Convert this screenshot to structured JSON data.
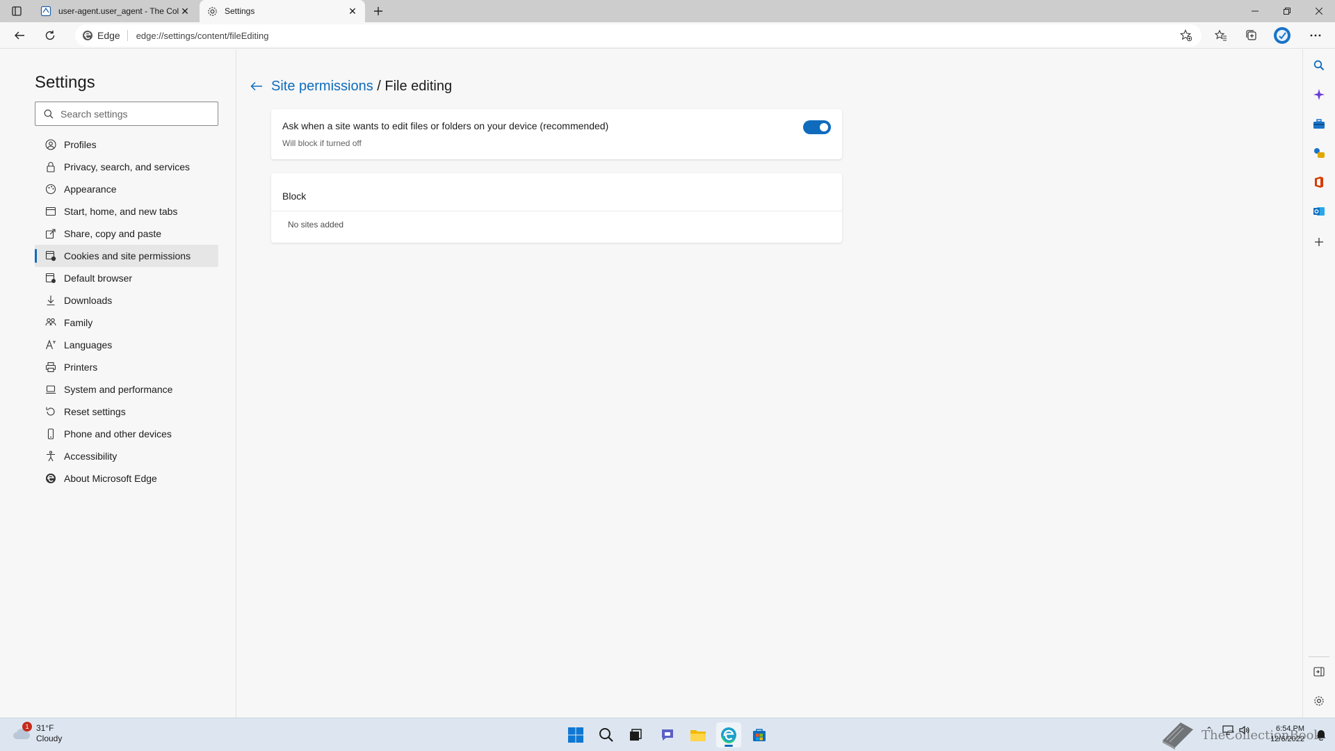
{
  "browser": {
    "tabs": [
      {
        "title": "user-agent.user_agent - The Coll",
        "icon": "document-tab-icon",
        "active": false
      },
      {
        "title": "Settings",
        "icon": "gear-icon",
        "active": true
      }
    ],
    "address": {
      "chip_label": "Edge",
      "url": "edge://settings/content/fileEditing"
    }
  },
  "settings": {
    "title": "Settings",
    "search_placeholder": "Search settings",
    "nav": [
      {
        "label": "Profiles",
        "icon": "profile-icon"
      },
      {
        "label": "Privacy, search, and services",
        "icon": "lock-icon"
      },
      {
        "label": "Appearance",
        "icon": "appearance-icon"
      },
      {
        "label": "Start, home, and new tabs",
        "icon": "home-tabs-icon"
      },
      {
        "label": "Share, copy and paste",
        "icon": "share-icon"
      },
      {
        "label": "Cookies and site permissions",
        "icon": "cookies-icon",
        "selected": true
      },
      {
        "label": "Default browser",
        "icon": "default-browser-icon"
      },
      {
        "label": "Downloads",
        "icon": "download-icon"
      },
      {
        "label": "Family",
        "icon": "family-icon"
      },
      {
        "label": "Languages",
        "icon": "languages-icon"
      },
      {
        "label": "Printers",
        "icon": "printer-icon"
      },
      {
        "label": "System and performance",
        "icon": "laptop-icon"
      },
      {
        "label": "Reset settings",
        "icon": "reset-icon"
      },
      {
        "label": "Phone and other devices",
        "icon": "phone-icon"
      },
      {
        "label": "Accessibility",
        "icon": "accessibility-icon"
      },
      {
        "label": "About Microsoft Edge",
        "icon": "edge-logo-icon"
      }
    ]
  },
  "page": {
    "breadcrumb_link": "Site permissions",
    "breadcrumb_sep": " / ",
    "breadcrumb_current": "File editing",
    "ask_label": "Ask when a site wants to edit files or folders on your device (recommended)",
    "ask_sub": "Will block if turned off",
    "ask_enabled": true,
    "block_heading": "Block",
    "block_empty": "No sites added"
  },
  "taskbar": {
    "weather_badge": "1",
    "temperature": "31°F",
    "condition": "Cloudy",
    "time": "6:54 PM",
    "date": "12/6/2022",
    "watermark": "TheCollectionBook"
  },
  "colors": {
    "accent": "#0f6cbd",
    "taskbar": "#dde6f0",
    "surface": "#f7f7f7"
  }
}
